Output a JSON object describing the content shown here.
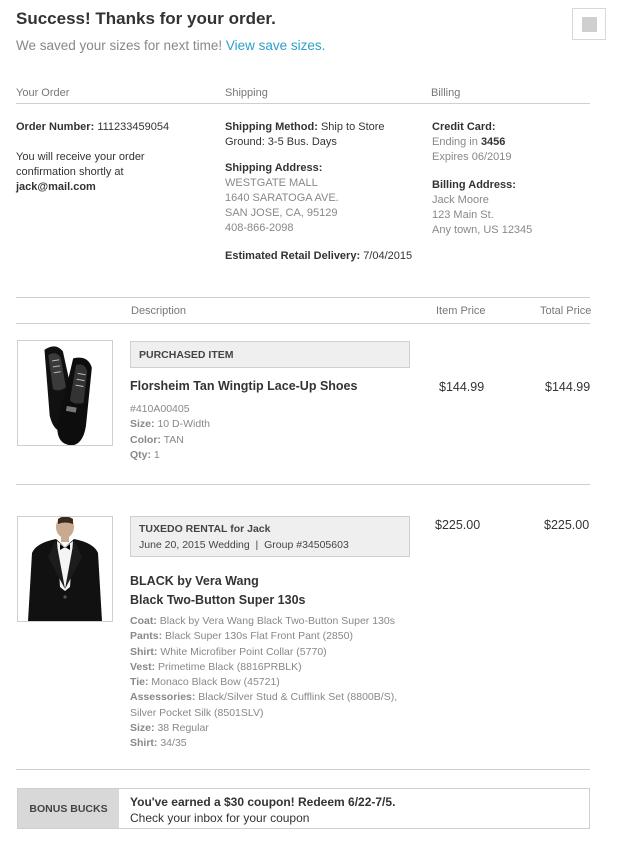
{
  "header": {
    "title": "Success! Thanks for your order.",
    "subtitle_prefix": "We saved your sizes for next time!",
    "subtitle_link": "View save sizes."
  },
  "order": {
    "heading": "Your Order",
    "number_label": "Order Number:",
    "number_value": "111233459054",
    "confirm_line1": "You will receive your order",
    "confirm_line2": "confirmation shortly at",
    "email": "jack@mail.com"
  },
  "shipping": {
    "heading": "Shipping",
    "method_label": "Shipping Method:",
    "method_value": "Ship to Store",
    "method_line2": "Ground: 3-5 Bus. Days",
    "address_label": "Shipping Address:",
    "address_lines": [
      "WESTGATE MALL",
      "1640 SARATOGA AVE.",
      "SAN JOSE, CA, 95129",
      "408-866-2098"
    ],
    "delivery_label": "Estimated Retail Delivery:",
    "delivery_value": "7/04/2015"
  },
  "billing": {
    "heading": "Billing",
    "card_label": "Credit Card:",
    "card_ending_prefix": "Ending in",
    "card_ending_digits": "3456",
    "card_expires": "Expires 06/2019",
    "address_label": "Billing Address:",
    "address_lines": [
      "Jack Moore",
      "123 Main St.",
      "Any town, US 12345"
    ]
  },
  "table": {
    "col_description": "Description",
    "col_item_price": "Item Price",
    "col_total_price": "Total Price"
  },
  "item1": {
    "badge": "PURCHASED ITEM",
    "name": "Florsheim Tan Wingtip Lace-Up Shoes",
    "sku": "#410A00405",
    "size_label": "Size:",
    "size_value": "10 D-Width",
    "color_label": "Color:",
    "color_value": "TAN",
    "qty_label": "Qty:",
    "qty_value": "1",
    "item_price": "$144.99",
    "total_price": "$144.99",
    "image_icon": "shoes-image"
  },
  "item2": {
    "badge_title": "TUXEDO RENTAL for Jack",
    "badge_subtitle": "June 20, 2015 Wedding  |  Group #34505603",
    "name_line1": "BLACK by Vera Wang",
    "name_line2": "Black Two-Button Super 130s",
    "details": [
      {
        "label": "Coat:",
        "value": "Black by Vera Wang Black Two-Button Super 130s"
      },
      {
        "label": "Pants:",
        "value": "Black Super 130s Flat Front Pant (2850)"
      },
      {
        "label": "Shirt:",
        "value": "White Microfiber Point Collar (5770)"
      },
      {
        "label": "Vest:",
        "value": "Primetime Black (8816PRBLK)"
      },
      {
        "label": "Tie:",
        "value": "Monaco Black Bow (45721)"
      },
      {
        "label": "Assessories:",
        "value": "Black/Silver Stud & Cufflink Set (8800B/S),"
      },
      {
        "label": "",
        "value": "Silver Pocket Silk (8501SLV)"
      },
      {
        "label": "Size:",
        "value": "38 Regular"
      },
      {
        "label": "Shirt:",
        "value": "34/35"
      }
    ],
    "item_price": "$225.00",
    "total_price": "$225.00",
    "image_icon": "tuxedo-image"
  },
  "bonus": {
    "label": "BONUS BUCKS",
    "headline": "You've earned a $30 coupon! Redeem 6/22-7/5.",
    "subline": "Check your inbox for your coupon"
  }
}
